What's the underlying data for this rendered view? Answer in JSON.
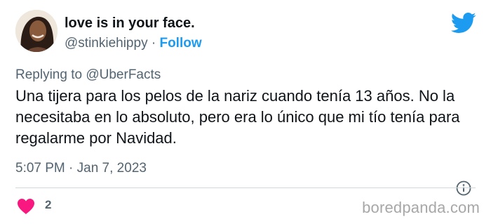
{
  "author": {
    "display_name": "love is in your face.",
    "handle": "@stinkiehippy",
    "separator": "·",
    "follow_label": "Follow"
  },
  "reply": {
    "prefix": "Replying to",
    "mention": "@UberFacts"
  },
  "tweet": {
    "text": "Una tijera para los pelos de la nariz cuando tenía 13 años. No la necesitaba en lo absoluto, pero era lo único que mi tío tenía para regalarme por Navidad.",
    "timestamp": "5:07 PM · Jan 7, 2023"
  },
  "stats": {
    "likes": "2"
  },
  "watermark": "boredpanda.com",
  "icons": {
    "brand": "twitter-bird-icon",
    "info": "info-icon",
    "like": "heart-icon"
  },
  "colors": {
    "twitter_blue": "#1d9bf0",
    "heart_pink": "#f91880",
    "muted_text": "#536471",
    "divider": "#cfd9de"
  }
}
